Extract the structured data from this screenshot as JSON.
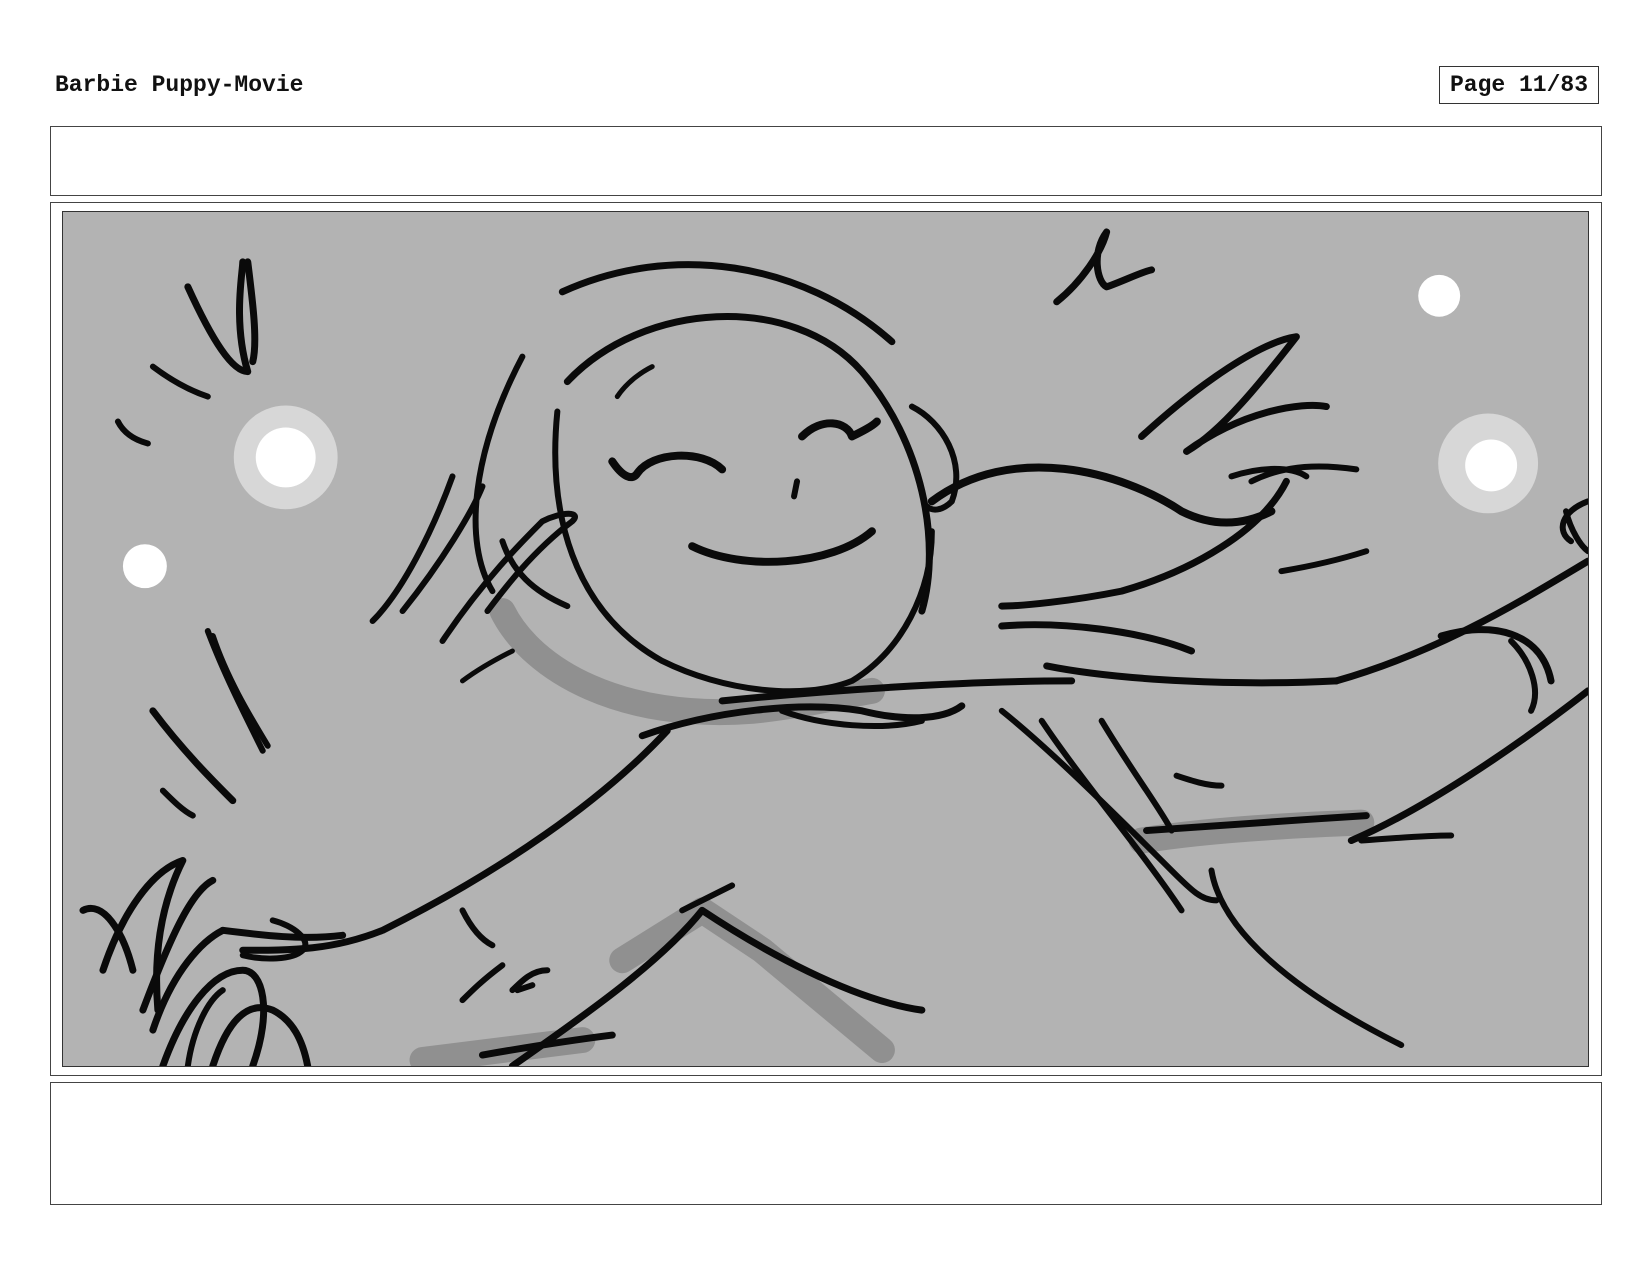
{
  "header": {
    "title": "Barbie Puppy-Movie",
    "page_label": "Page 11/83"
  },
  "panel": {
    "sketch_icon": "storyboard-sketch-girl-smiling",
    "background_color": "#b3b3b3",
    "ink_color": "#0a0a0a",
    "shadow_color": "#8c8c8c"
  },
  "notes": {
    "top": "",
    "bottom": ""
  }
}
